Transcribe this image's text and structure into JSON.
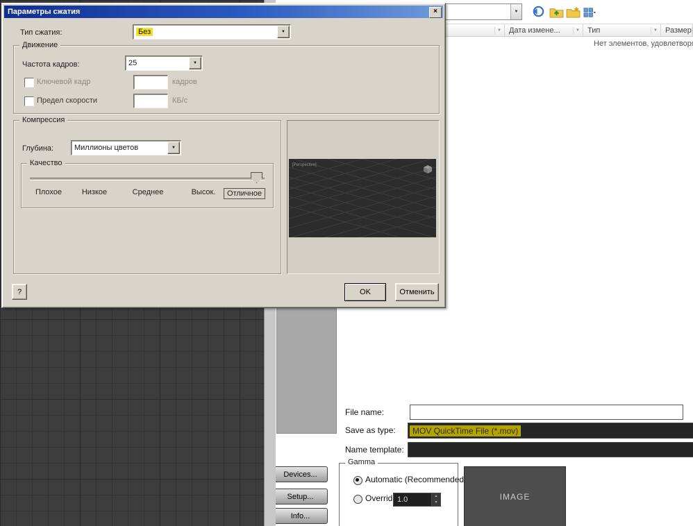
{
  "glyphs": {
    "dropdown_arrow": "▼",
    "close": "×",
    "spinner_up": "▲",
    "spinner_down": "▼",
    "help": "?"
  },
  "icons": [
    "back-icon",
    "up-one-level-icon",
    "create-new-folder-icon",
    "view-menu-icon",
    "chevron-down-icon",
    "viewcube-icon"
  ],
  "compression_dialog": {
    "title": "Параметры сжатия",
    "type_label": "Тип сжатия:",
    "type_value": "Без",
    "motion": {
      "title": "Движение",
      "frame_rate_label": "Частота кадров:",
      "frame_rate_value": "25",
      "keyframe_label": "Ключевой кадр",
      "keyframe_value": "",
      "keyframe_unit": "кадров",
      "rate_limit_label": "Предел скорости",
      "rate_limit_value": "",
      "rate_limit_unit": "КБ/с"
    },
    "compression": {
      "title": "Компрессия",
      "depth_label": "Глубина:",
      "depth_value": "Миллионы цветов",
      "quality": {
        "title": "Качество",
        "levels": [
          "Плохое",
          "Низкое",
          "Среднее",
          "Высок.",
          "Отличное"
        ],
        "selected": "Отличное"
      }
    },
    "preview_label": "[Perspective]",
    "ok_button": "OK",
    "cancel_button": "Отменить"
  },
  "file_browser": {
    "columns": [
      {
        "label": ""
      },
      {
        "label": "Дата измене..."
      },
      {
        "label": "Тип"
      },
      {
        "label": "Размер"
      }
    ],
    "empty_message": "Нет элементов, удовлетворяющих у"
  },
  "save_dialog": {
    "file_name_label": "File name:",
    "file_name_value": "",
    "save_type_label": "Save as type:",
    "save_type_value": "MOV QuickTime File (*.mov)",
    "template_label": "Name template:",
    "template_value": "",
    "devices_button": "Devices...",
    "setup_button": "Setup...",
    "info_button": "Info...",
    "gamma": {
      "title": "Gamma",
      "automatic_label": "Automatic (Recommended)",
      "override_label": "Override",
      "override_value": "1.0"
    },
    "image_placeholder": "IMAGE"
  }
}
